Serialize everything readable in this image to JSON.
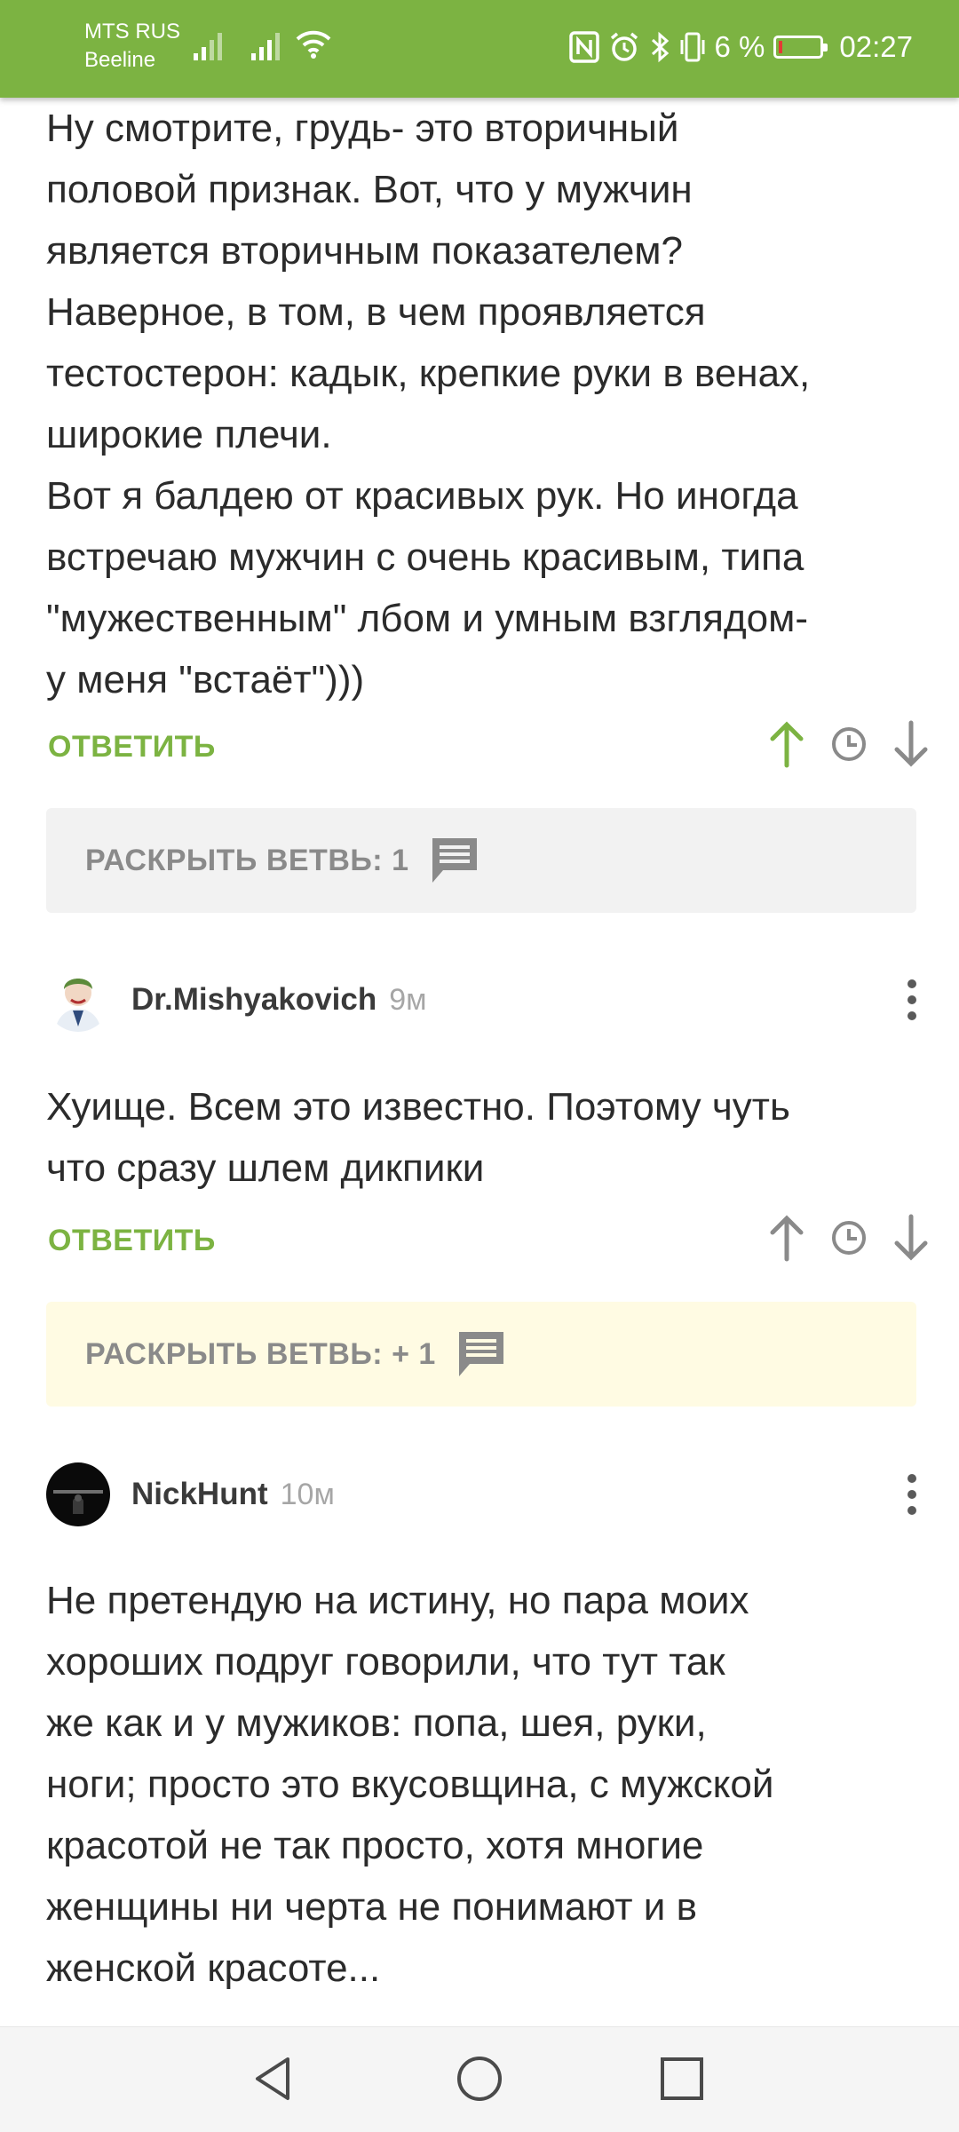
{
  "status_bar": {
    "carrier1": "MTS RUS",
    "carrier2": "Beeline",
    "battery": "6 %",
    "time": "02:27",
    "battery_level": 0.06,
    "accent": "#7cb342"
  },
  "comment1": {
    "text": "Ну смотрите, грудь- это вторичный\nполовой признак. Вот, что у мужчин\nявляется вторичным показателем?\nНаверное, в том, в чем проявляется\nтестостерон: кадык, крепкие руки в венах,\nширокие плечи.\nВот я балдею от красивых рук. Но иногда\nвстречаю мужчин с очень красивым, типа\n\"мужественным\" лбом и умным взглядом-\nу меня \"встаёт\")))",
    "reply_label": "ОТВЕТИТЬ",
    "expand_label": "РАСКРЫТЬ ВЕТВЬ: 1"
  },
  "comment2": {
    "author": "Dr.Mishyakovich",
    "time": "9м",
    "text": "Хуище. Всем это известно. Поэтому чуть\nчто сразу шлем дикпики",
    "reply_label": "ОТВЕТИТЬ",
    "expand_label": "РАСКРЫТЬ ВЕТВЬ: + 1"
  },
  "comment3": {
    "author": "NickHunt",
    "time": "10м",
    "text": "Не претендую на истину, но пара моих\nхороших подруг говорили, что тут так\nже как и у мужиков: попа, шея, руки,\nноги; просто это вкусовщина, с мужской\nкрасотой не так просто, хотя многие\nженщины ни черта не понимают и в\nженской красоте..."
  },
  "icons": {
    "upvote": "arrow-up-icon",
    "time": "clock-icon",
    "downvote": "arrow-down-icon",
    "expand": "comment-icon",
    "more": "more-vertical-icon"
  }
}
